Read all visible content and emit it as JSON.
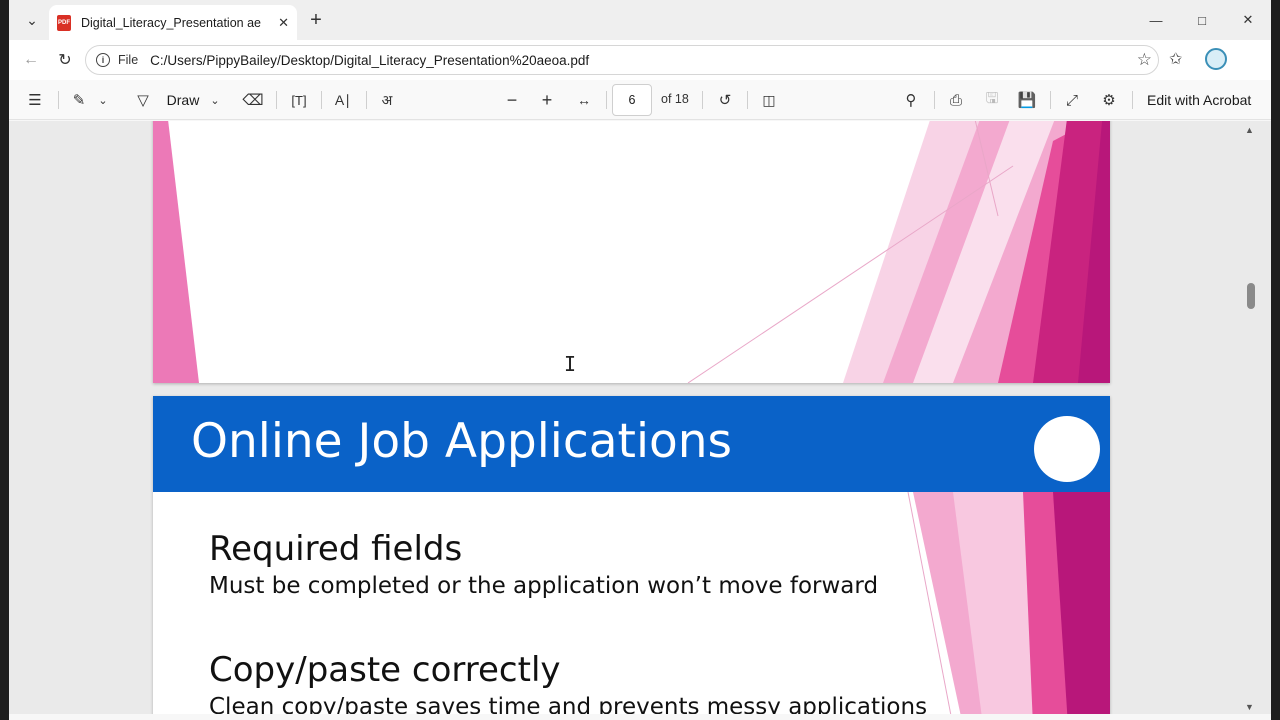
{
  "browser": {
    "tab_title": "Digital_Literacy_Presentation aeoa.pdf",
    "pdf_badge": "PDF",
    "url_scheme_label": "File",
    "url": "C:/Users/PippyBailey/Desktop/Digital_Literacy_Presentation%20aeoa.pdf",
    "window_controls": [
      "minimize-icon",
      "maximize-icon",
      "close-icon"
    ]
  },
  "pdf_toolbar": {
    "draw_label": "Draw",
    "current_page": "6",
    "page_total": "of 18",
    "edit_label": "Edit with Acrobat"
  },
  "slides": {
    "current": {
      "title": "Online Job Applications",
      "items": [
        {
          "heading": "Required fields",
          "text": "Must be completed or the application won’t move forward"
        },
        {
          "heading": "Copy/paste correctly",
          "text": "Clean copy/paste saves time and prevents messy applications"
        }
      ]
    }
  },
  "colors": {
    "title_band": "#0a62c8",
    "accent_pink": "#e64d9a",
    "accent_magenta": "#b8177a"
  },
  "scroll_position": 0.33
}
